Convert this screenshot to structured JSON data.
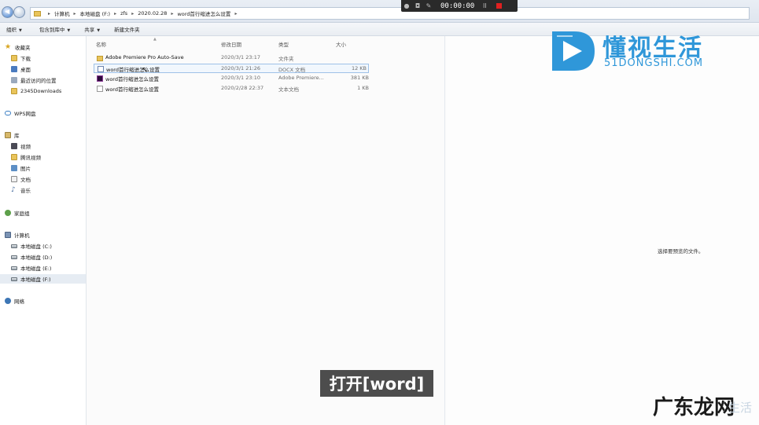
{
  "address_bar": {
    "crumbs": [
      "计算机",
      "本地磁盘 (F:)",
      "zfs",
      "2020.02.28",
      "word首行缩进怎么设置"
    ]
  },
  "recorder": {
    "time": "00:00:00",
    "pause": "II"
  },
  "toolbar": {
    "organize": "组织",
    "include": "包含到库中",
    "share": "共享",
    "new_folder": "新建文件夹"
  },
  "nav": {
    "favorites": "收藏夹",
    "downloads": "下载",
    "desktop": "桌面",
    "recent": "最近访问的位置",
    "downloads2345": "2345Downloads",
    "wps": "WPS网盘",
    "library": "库",
    "videos": "视频",
    "tencent_video": "腾讯视频",
    "pictures": "图片",
    "documents": "文档",
    "music": "音乐",
    "homegroup": "家庭组",
    "computer": "计算机",
    "drive_c": "本地磁盘 (C:)",
    "drive_d": "本地磁盘 (D:)",
    "drive_e": "本地磁盘 (E:)",
    "drive_f": "本地磁盘 (F:)",
    "network": "网络"
  },
  "columns": {
    "name": "名称",
    "modified": "修改日期",
    "type": "类型",
    "size": "大小"
  },
  "files": [
    {
      "name": "Adobe Premiere Pro Auto-Save",
      "date": "2020/3/1 23:17",
      "type": "文件夹",
      "size": "",
      "icon": "folder-icon"
    },
    {
      "name": "word首行缩进怎么设置",
      "date": "2020/3/1 21:26",
      "type": "DOCX 文档",
      "size": "12 KB",
      "icon": "word-document-icon"
    },
    {
      "name": "word首行缩进怎么设置",
      "date": "2020/3/1 23:10",
      "type": "Adobe Premiere...",
      "size": "381 KB",
      "icon": "premiere-project-icon"
    },
    {
      "name": "word首行缩进怎么设置",
      "date": "2020/2/28 22:37",
      "type": "文本文档",
      "size": "1 KB",
      "icon": "text-document-icon"
    }
  ],
  "preview": {
    "message": "选择要预览的文件。"
  },
  "logo": {
    "name_cn": "懂视生活",
    "name_en": "51DONGSHI.COM",
    "color": "#2f97d9"
  },
  "caption": "打开[word]",
  "watermark": {
    "text": "广东龙网",
    "ghost": "生活"
  }
}
